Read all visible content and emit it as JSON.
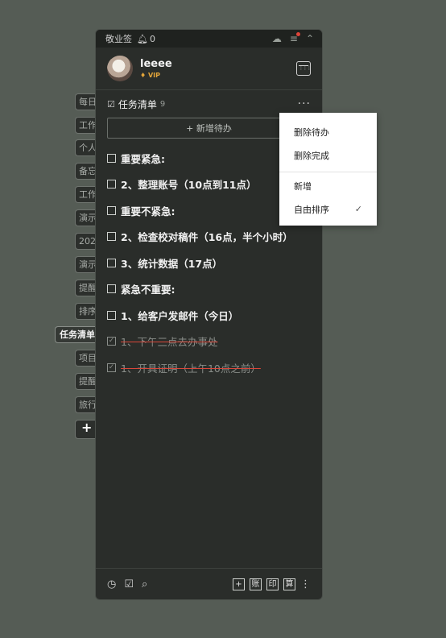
{
  "side_tabs": [
    "每日",
    "工作",
    "个人",
    "备忘",
    "工作",
    "演示",
    "202",
    "演示",
    "提醒",
    "排序",
    "任务清单",
    "项目",
    "提醒",
    "旅行",
    "+"
  ],
  "active_tab_index": 10,
  "titlebar": {
    "app_name": "敬业签",
    "notification_count": "0"
  },
  "user": {
    "name": "leeee",
    "badge": "VIP"
  },
  "list": {
    "title": "任务清单",
    "count": "9",
    "more": "···",
    "add_label": "+ 新增待办",
    "items": [
      {
        "text": "重要紧急:",
        "done": false
      },
      {
        "text": "2、整理账号（10点到11点）",
        "done": false
      },
      {
        "text": "重要不紧急:",
        "done": false
      },
      {
        "text": "2、检查校对稿件（16点，半个小时）",
        "done": false
      },
      {
        "text": "3、统计数据（17点）",
        "done": false
      },
      {
        "text": "紧急不重要:",
        "done": false
      },
      {
        "text": "1、给客户发邮件（今日）",
        "done": false
      },
      {
        "text": "1、下午三点去办事处",
        "done": true
      },
      {
        "text": "1、开具证明（上午10点之前）",
        "done": true
      }
    ]
  },
  "menu": {
    "delete_todo": "删除待办",
    "delete_done": "删除完成",
    "new": "新增",
    "free_sort": "自由排序",
    "check": "✓"
  },
  "footer": {
    "left_icons": [
      "clock-icon",
      "calendar-check-icon",
      "search-icon"
    ],
    "right_buttons": [
      "+",
      "账",
      "印",
      "算"
    ]
  },
  "colors": {
    "strike": "#d9463a",
    "vip": "#e3a53a",
    "notify_dot": "#e0453a"
  }
}
